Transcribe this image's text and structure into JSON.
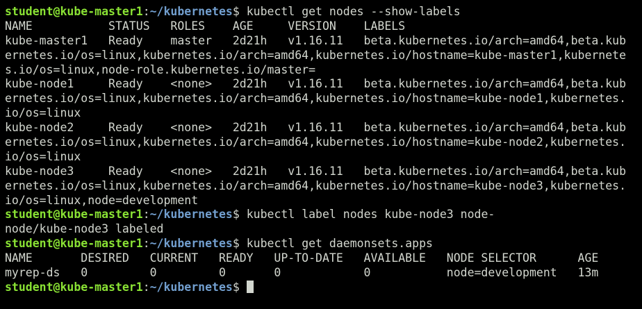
{
  "colors": {
    "background": "#000000",
    "text": "#d3d7cf",
    "prompt_user": "#8ae234",
    "prompt_path": "#729fcf"
  },
  "prompt": {
    "user_host": "student@kube-master1",
    "separator": ":",
    "path": "~/kubernetes",
    "symbol": "$ "
  },
  "lines": [
    {
      "type": "prompt",
      "command": "kubectl get nodes --show-labels"
    },
    {
      "type": "output",
      "text": "NAME           STATUS   ROLES    AGE     VERSION    LABELS"
    },
    {
      "type": "output",
      "text": "kube-master1   Ready    master   2d21h   v1.16.11   beta.kubernetes.io/arch=amd64,beta.kub"
    },
    {
      "type": "output",
      "text": "ernetes.io/os=linux,kubernetes.io/arch=amd64,kubernetes.io/hostname=kube-master1,kubernete"
    },
    {
      "type": "output",
      "text": "s.io/os=linux,node-role.kubernetes.io/master="
    },
    {
      "type": "output",
      "text": "kube-node1     Ready    <none>   2d21h   v1.16.11   beta.kubernetes.io/arch=amd64,beta.kub"
    },
    {
      "type": "output",
      "text": "ernetes.io/os=linux,kubernetes.io/arch=amd64,kubernetes.io/hostname=kube-node1,kubernetes."
    },
    {
      "type": "output",
      "text": "io/os=linux"
    },
    {
      "type": "output",
      "text": "kube-node2     Ready    <none>   2d21h   v1.16.11   beta.kubernetes.io/arch=amd64,beta.kub"
    },
    {
      "type": "output",
      "text": "ernetes.io/os=linux,kubernetes.io/arch=amd64,kubernetes.io/hostname=kube-node2,kubernetes."
    },
    {
      "type": "output",
      "text": "io/os=linux"
    },
    {
      "type": "output",
      "text": "kube-node3     Ready    <none>   2d21h   v1.16.11   beta.kubernetes.io/arch=amd64,beta.kub"
    },
    {
      "type": "output",
      "text": "ernetes.io/os=linux,kubernetes.io/arch=amd64,kubernetes.io/hostname=kube-node3,kubernetes."
    },
    {
      "type": "output",
      "text": "io/os=linux,node=development"
    },
    {
      "type": "prompt",
      "command": "kubectl label nodes kube-node3 node-"
    },
    {
      "type": "output",
      "text": "node/kube-node3 labeled"
    },
    {
      "type": "prompt",
      "command": "kubectl get daemonsets.apps"
    },
    {
      "type": "output",
      "text": "NAME       DESIRED   CURRENT   READY   UP-TO-DATE   AVAILABLE   NODE SELECTOR      AGE"
    },
    {
      "type": "output",
      "text": "myrep-ds   0         0         0       0            0           node=development   13m"
    },
    {
      "type": "prompt",
      "command": "",
      "cursor": true
    }
  ]
}
